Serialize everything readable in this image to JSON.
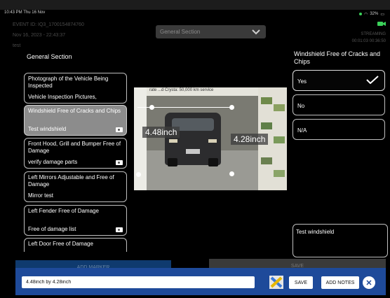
{
  "status_bar": {
    "time": "10:43 PM Thu 16 Nov",
    "battery": "32%"
  },
  "event": {
    "id": "EVENT ID: IQ3_1700154874760",
    "date": "Nov 16, 2023 - 22:43:37",
    "extra": "test"
  },
  "stream": {
    "label": "STREAMING",
    "timer": "00:01:03 00:36:50"
  },
  "section_dropdown": {
    "value": "General Section"
  },
  "left_panel": {
    "title": "General Section",
    "items": [
      {
        "title": "Photograph of the Vehicle Being Inspected",
        "sub": "Vehicle Inspection Pictures,"
      },
      {
        "title": "Windshield Free of Cracks and Chips",
        "sub": "Test windshield"
      },
      {
        "title": "Front Hood, Grill and Bumper Free of Damage",
        "sub": "verify damage parts"
      },
      {
        "title": "Left Mirrors Adjustable and Free of Damage",
        "sub": "Mirror test"
      },
      {
        "title": "Left Fender Free of Damage",
        "sub": "Free of damage list"
      },
      {
        "title": "Left Door Free of Damage",
        "sub": ""
      }
    ]
  },
  "photo": {
    "caption": "rate            ...d Crysta: 50,000 km service",
    "measure_1": "4.48inch",
    "measure_2": "4.28inch"
  },
  "right_panel": {
    "title": "Windshield Free of Cracks and Chips",
    "options": [
      "Yes",
      "No",
      "N/A"
    ],
    "selected": "Yes",
    "notes": "Test windshield"
  },
  "bg_buttons": {
    "left": "ADD MARKER",
    "right": "SAVE"
  },
  "bottom_bar": {
    "measurement_value": "4.48inch by 4.28inch",
    "save_label": "SAVE",
    "add_notes_label": "ADD NOTES",
    "close_label": "✕"
  },
  "colors": {
    "bar": "#1e4a9a",
    "active_item": "#8c8c8c",
    "background": "#000000"
  }
}
